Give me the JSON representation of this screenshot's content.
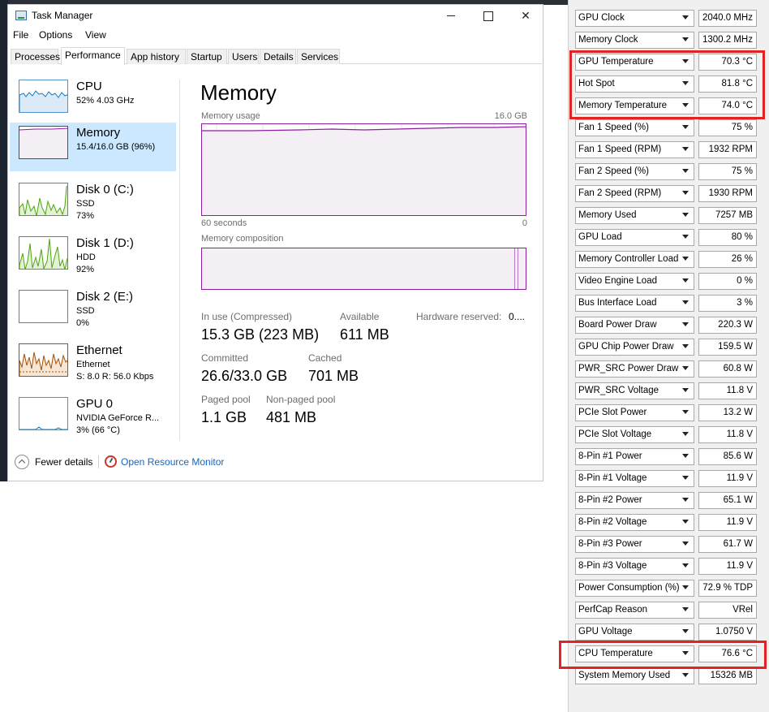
{
  "task_manager": {
    "title": "Task Manager",
    "menu": [
      "File",
      "Options",
      "View"
    ],
    "tabs": [
      "Processes",
      "Performance",
      "App history",
      "Startup",
      "Users",
      "Details",
      "Services"
    ],
    "active_tab": "Performance",
    "devices": [
      {
        "name": "CPU",
        "line1": "52%  4.03 GHz",
        "line2": ""
      },
      {
        "name": "Memory",
        "line1": "15.4/16.0 GB (96%)",
        "line2": ""
      },
      {
        "name": "Disk 0 (C:)",
        "line1": "SSD",
        "line2": "73%"
      },
      {
        "name": "Disk 1 (D:)",
        "line1": "HDD",
        "line2": "92%"
      },
      {
        "name": "Disk 2 (E:)",
        "line1": "SSD",
        "line2": "0%"
      },
      {
        "name": "Ethernet",
        "line1": "Ethernet",
        "line2": "S: 8.0  R: 56.0 Kbps"
      },
      {
        "name": "GPU 0",
        "line1": "NVIDIA GeForce R...",
        "line2": "3% (66 °C)"
      }
    ],
    "memory": {
      "title": "Memory",
      "usage_label": "Memory usage",
      "usage_max": "16.0 GB",
      "axis_left": "60 seconds",
      "axis_right": "0",
      "composition_label": "Memory composition",
      "stats": {
        "in_use_label": "In use (Compressed)",
        "in_use_value": "15.3 GB (223 MB)",
        "available_label": "Available",
        "available_value": "611 MB",
        "hw_reserved_label": "Hardware reserved:",
        "hw_reserved_value": "0....",
        "committed_label": "Committed",
        "committed_value": "26.6/33.0 GB",
        "cached_label": "Cached",
        "cached_value": "701 MB",
        "paged_label": "Paged pool",
        "paged_value": "1.1 GB",
        "nonpaged_label": "Non-paged pool",
        "nonpaged_value": "481 MB"
      }
    },
    "footer": {
      "fewer_details": "Fewer details",
      "open_resource_monitor": "Open Resource Monitor"
    }
  },
  "gpuz_sensors": [
    {
      "name": "GPU Clock",
      "value": "2040.0 MHz"
    },
    {
      "name": "Memory Clock",
      "value": "1300.2 MHz"
    },
    {
      "name": "GPU Temperature",
      "value": "70.3 °C"
    },
    {
      "name": "Hot Spot",
      "value": "81.8 °C"
    },
    {
      "name": "Memory Temperature",
      "value": "74.0 °C"
    },
    {
      "name": "Fan 1 Speed (%)",
      "value": "75 %"
    },
    {
      "name": "Fan 1 Speed (RPM)",
      "value": "1932 RPM"
    },
    {
      "name": "Fan 2 Speed (%)",
      "value": "75 %"
    },
    {
      "name": "Fan 2 Speed (RPM)",
      "value": "1930 RPM"
    },
    {
      "name": "Memory Used",
      "value": "7257 MB"
    },
    {
      "name": "GPU Load",
      "value": "80 %"
    },
    {
      "name": "Memory Controller Load",
      "value": "26 %"
    },
    {
      "name": "Video Engine Load",
      "value": "0 %"
    },
    {
      "name": "Bus Interface Load",
      "value": "3 %"
    },
    {
      "name": "Board Power Draw",
      "value": "220.3 W"
    },
    {
      "name": "GPU Chip Power Draw",
      "value": "159.5 W"
    },
    {
      "name": "PWR_SRC Power Draw",
      "value": "60.8 W"
    },
    {
      "name": "PWR_SRC Voltage",
      "value": "11.8 V"
    },
    {
      "name": "PCIe Slot Power",
      "value": "13.2 W"
    },
    {
      "name": "PCIe Slot Voltage",
      "value": "11.8 V"
    },
    {
      "name": "8-Pin #1 Power",
      "value": "85.6 W"
    },
    {
      "name": "8-Pin #1 Voltage",
      "value": "11.9 V"
    },
    {
      "name": "8-Pin #2 Power",
      "value": "65.1 W"
    },
    {
      "name": "8-Pin #2 Voltage",
      "value": "11.9 V"
    },
    {
      "name": "8-Pin #3 Power",
      "value": "61.7 W"
    },
    {
      "name": "8-Pin #3 Voltage",
      "value": "11.9 V"
    },
    {
      "name": "Power Consumption (%)",
      "value": "72.9 % TDP"
    },
    {
      "name": "PerfCap Reason",
      "value": "VRel"
    },
    {
      "name": "GPU Voltage",
      "value": "1.0750 V"
    },
    {
      "name": "CPU Temperature",
      "value": "76.6 °C"
    },
    {
      "name": "System Memory Used",
      "value": "15326 MB"
    }
  ],
  "colors": {
    "memory_accent": "#8b1fa0",
    "cpu_accent": "#117dbb",
    "disk_accent": "#4da60c",
    "ethernet_accent": "#a74f01",
    "selection": "#cce8ff",
    "highlight": "#e02424",
    "link": "#1565c0"
  }
}
